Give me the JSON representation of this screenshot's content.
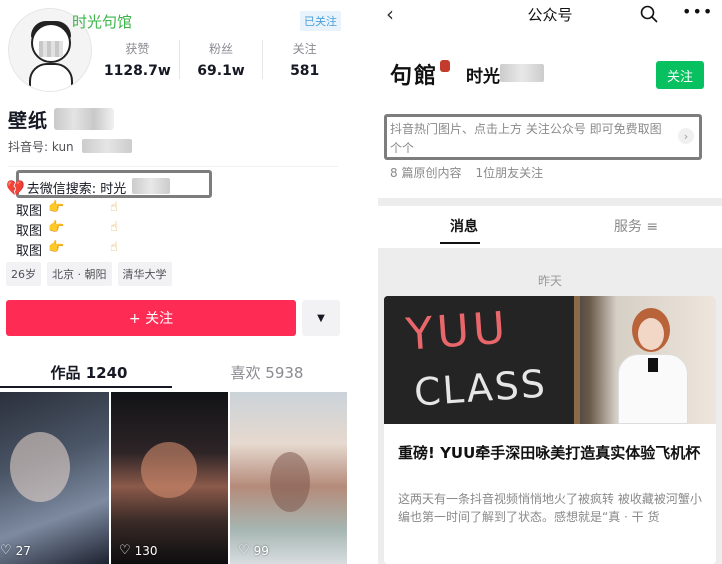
{
  "douyin": {
    "account_name_top": "时光句馆",
    "followed_badge": "已关注",
    "stats": [
      {
        "label": "获赞",
        "value": "1128.7w"
      },
      {
        "label": "粉丝",
        "value": "69.1w"
      },
      {
        "label": "关注",
        "value": "581"
      }
    ],
    "nickname": "壁纸",
    "douyin_id": "抖音号: kun",
    "bio_search": "去微信搜索: 时光",
    "bio_rows": [
      "取图",
      "取图",
      "取图"
    ],
    "tags": [
      "26岁",
      "北京 · 朝阳",
      "清华大学"
    ],
    "follow_button": "+ 关注",
    "more_button_icon": "triangle-down",
    "tabs": [
      {
        "label": "作品 1240",
        "active": true
      },
      {
        "label": "喜欢 5938",
        "active": false
      }
    ],
    "videos": [
      {
        "likes": "27"
      },
      {
        "likes": "130"
      },
      {
        "likes": "99"
      }
    ],
    "colors": {
      "accent": "#fe2c55",
      "badge": "#4a9fd8",
      "name_green": "#3cb44a"
    }
  },
  "wechat": {
    "nav_title": "公众号",
    "back_icon": "chevron-left-icon",
    "search_icon": "search-icon",
    "more_icon": "more-dots-icon",
    "logo_text": "句館",
    "account_name": "时光",
    "follow_button": "关注",
    "description": "抖音热门图片、点击上方 关注公众号 即可免费取图个个",
    "meta": [
      "8 篇原创内容",
      "1位朋友关注"
    ],
    "tabs": [
      {
        "label": "消息",
        "active": true
      },
      {
        "label": "服务 ≡",
        "active": false
      }
    ],
    "date_label": "昨天",
    "article": {
      "cover_text_1": "YUU",
      "cover_text_2": "CLASS",
      "title": "重磅! YUU牵手深田咏美打造真实体验飞机杯",
      "summary": "这两天有一条抖音视频悄悄地火了被疯转 被收藏被河蟹小编也第一时间了解到了状态。感想就是“真 · 干 货"
    },
    "colors": {
      "follow_green": "#07c160"
    }
  }
}
